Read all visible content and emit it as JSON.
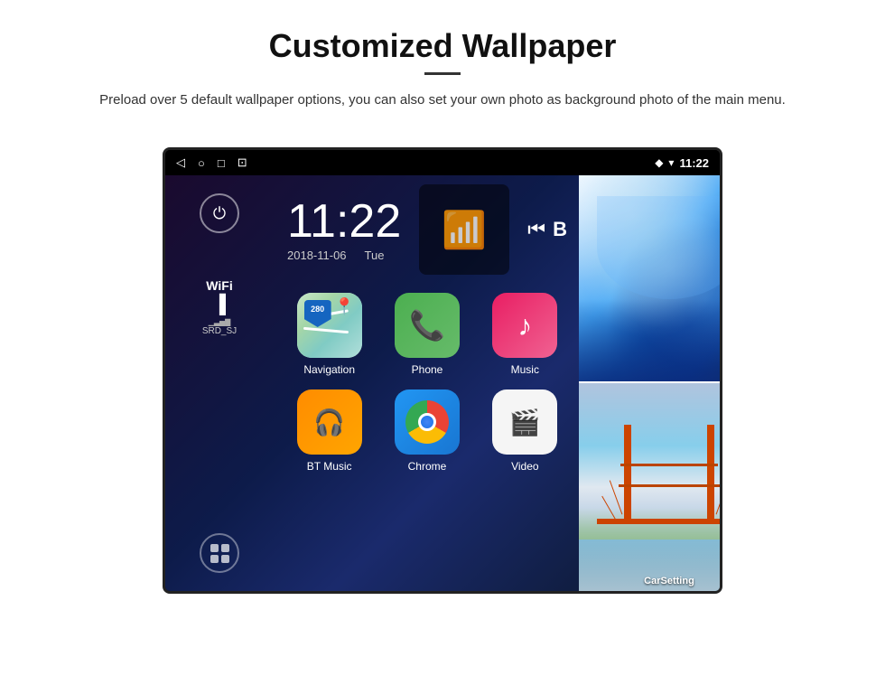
{
  "header": {
    "title": "Customized Wallpaper",
    "subtitle": "Preload over 5 default wallpaper options, you can also set your own photo as background photo of the main menu."
  },
  "device": {
    "status_bar": {
      "time": "11:22",
      "wifi_icon": "▼",
      "location_icon": "◆"
    },
    "clock": {
      "time": "11:22",
      "date": "2018-11-06",
      "day": "Tue"
    },
    "sidebar": {
      "wifi_label": "WiFi",
      "wifi_network": "SRD_SJ"
    },
    "apps": [
      {
        "label": "Navigation",
        "icon": "nav"
      },
      {
        "label": "Phone",
        "icon": "phone"
      },
      {
        "label": "Music",
        "icon": "music"
      },
      {
        "label": "BT Music",
        "icon": "bt"
      },
      {
        "label": "Chrome",
        "icon": "chrome"
      },
      {
        "label": "Video",
        "icon": "video"
      }
    ],
    "wallpapers": [
      {
        "type": "ice_cave",
        "label": ""
      },
      {
        "type": "bridge",
        "label": "CarSetting"
      }
    ]
  }
}
